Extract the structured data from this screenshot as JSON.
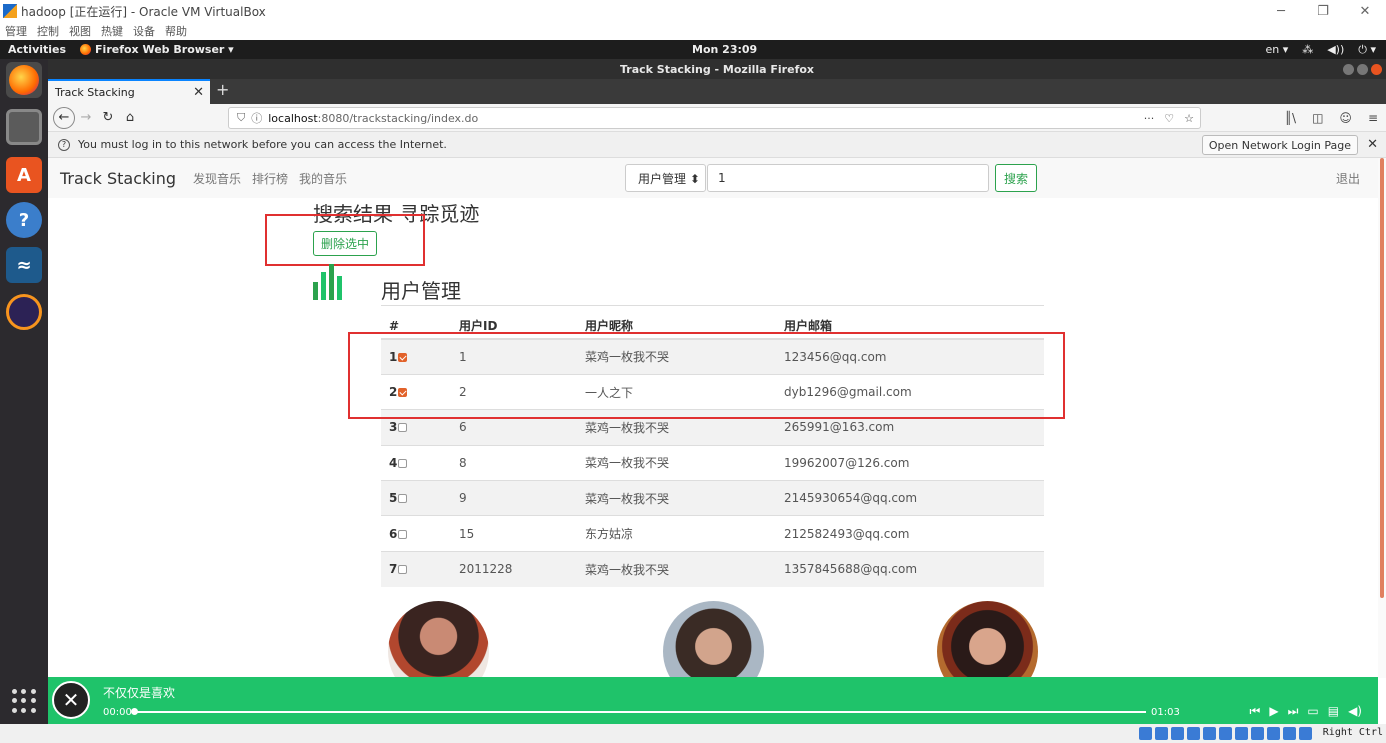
{
  "vbox": {
    "title": "hadoop [正在运行] - Oracle VM VirtualBox",
    "menu": [
      "管理",
      "控制",
      "视图",
      "热键",
      "设备",
      "帮助"
    ],
    "host_key": "Right Ctrl"
  },
  "gnome": {
    "activities": "Activities",
    "app_menu": "Firefox Web Browser ▾",
    "clock": "Mon 23:09",
    "lang": "en ▾"
  },
  "firefox": {
    "window_title": "Track Stacking - Mozilla Firefox",
    "tab_title": "Track Stacking",
    "url_host": "localhost",
    "url_rest": ":8080/trackstacking/index.do",
    "notice": "You must log in to this network before you can access the Internet.",
    "notice_button": "Open Network Login Page"
  },
  "site": {
    "brand": "Track Stacking",
    "nav": [
      "发现音乐",
      "排行榜",
      "我的音乐"
    ],
    "search_category": "用户管理 ⬍",
    "search_value": "1",
    "search_button": "搜索",
    "logout": "退出"
  },
  "main": {
    "heading": "搜索结果 寻踪觅迹",
    "delete_button": "删除选中",
    "section_title": "用户管理",
    "columns": [
      "#",
      "用户ID",
      "用户昵称",
      "用户邮箱"
    ],
    "rows": [
      {
        "num": "1",
        "checked": true,
        "id": "1",
        "nick": "菜鸡一枚我不哭",
        "email": "123456@qq.com"
      },
      {
        "num": "2",
        "checked": true,
        "id": "2",
        "nick": "一人之下",
        "email": "dyb1296@gmail.com"
      },
      {
        "num": "3",
        "checked": false,
        "id": "6",
        "nick": "菜鸡一枚我不哭",
        "email": "265991@163.com"
      },
      {
        "num": "4",
        "checked": false,
        "id": "8",
        "nick": "菜鸡一枚我不哭",
        "email": "19962007@126.com"
      },
      {
        "num": "5",
        "checked": false,
        "id": "9",
        "nick": "菜鸡一枚我不哭",
        "email": "2145930654@qq.com"
      },
      {
        "num": "6",
        "checked": false,
        "id": "15",
        "nick": "东方姑凉",
        "email": "212582493@qq.com"
      },
      {
        "num": "7",
        "checked": false,
        "id": "2011228",
        "nick": "菜鸡一枚我不哭",
        "email": "1357845688@qq.com"
      }
    ]
  },
  "player": {
    "song": "不仅仅是喜欢",
    "current_time": "00:00",
    "duration": "01:03",
    "progress": 0.0
  },
  "colors": {
    "accent_green": "#2ca24d",
    "player_green": "#1fc36a",
    "highlight_red": "#e03030"
  }
}
